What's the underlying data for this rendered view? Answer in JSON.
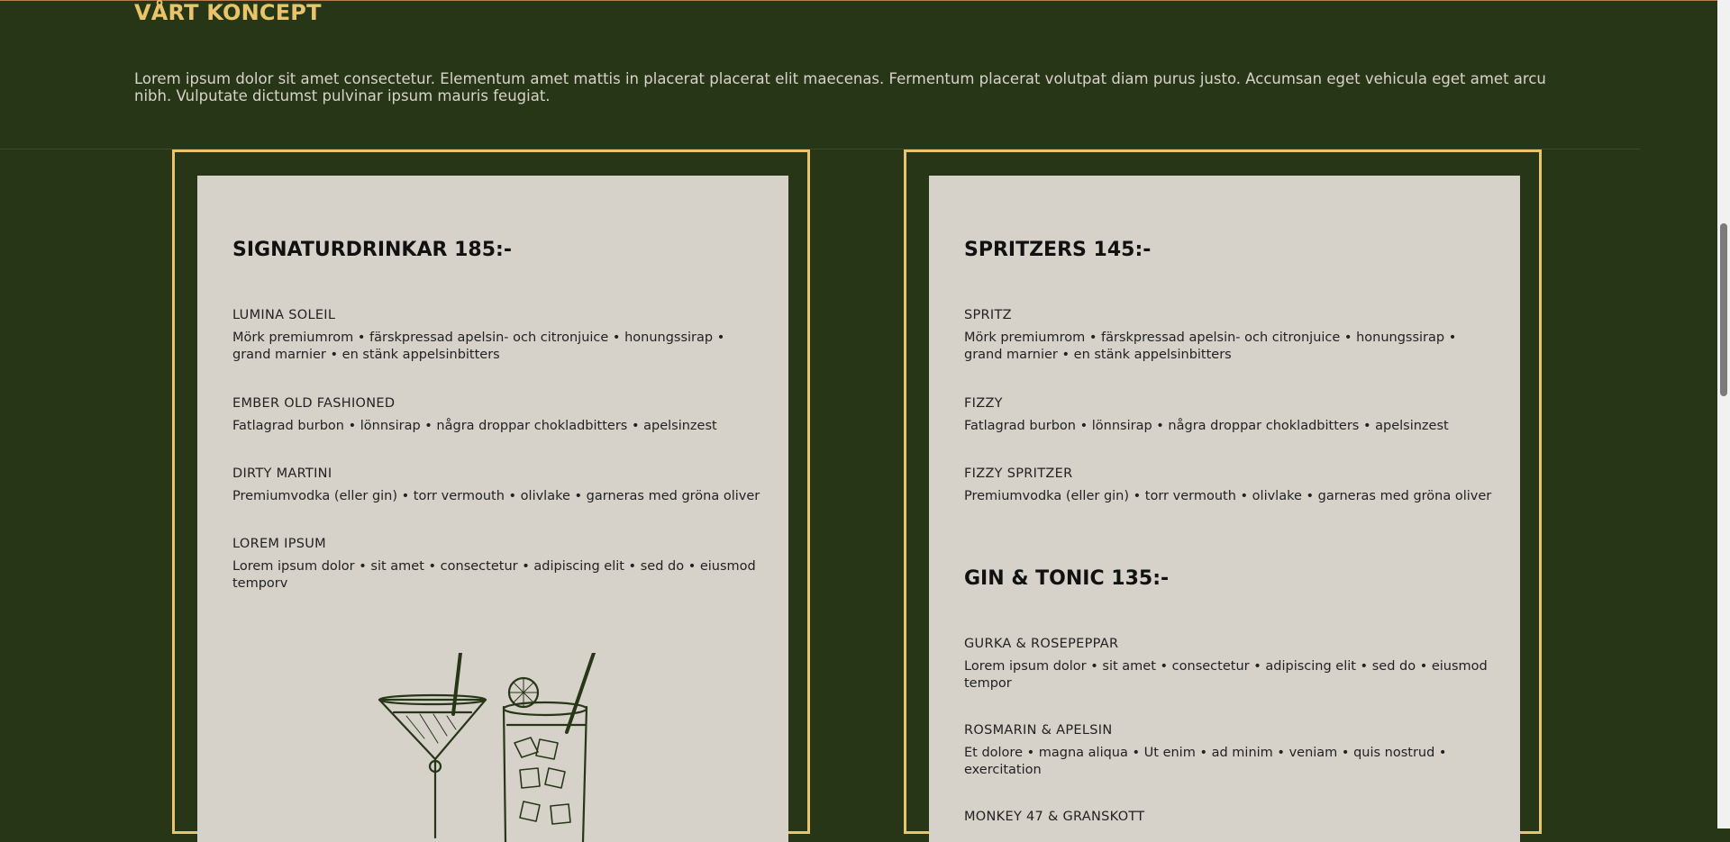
{
  "concept": {
    "title": "VÅRT KONCEPT",
    "text": "Lorem ipsum dolor sit amet consectetur. Elementum amet mattis in placerat placerat elit maecenas. Fermentum placerat volutpat diam purus justo. Accumsan eget vehicula eget amet arcu nibh. Vulputate dictumst pulvinar ipsum mauris feugiat."
  },
  "left_menu": {
    "title": "SIGNATURDRINKAR 185:-",
    "items": [
      {
        "name": "LUMINA SOLEIL",
        "desc": "Mörk premiumrom • färskpressad apelsin- och citronjuice • honungssirap • grand marnier • en stänk appelsinbitters"
      },
      {
        "name": "EMBER OLD FASHIONED",
        "desc": "Fatlagrad burbon • lönnsirap • några droppar chokladbitters • apelsinzest"
      },
      {
        "name": "DIRTY MARTINI",
        "desc": "Premiumvodka (eller gin) • torr vermouth • olivlake • garneras med gröna oliver"
      },
      {
        "name": "LOREM IPSUM",
        "desc": "Lorem ipsum dolor • sit amet • consectetur • adipiscing elit • sed do • eiusmod temporv"
      }
    ],
    "illustration_icon": "cocktail-glasses-illustration"
  },
  "right_menu": {
    "sections": [
      {
        "title": "SPRITZERS 145:-",
        "items": [
          {
            "name": "SPRITZ",
            "desc": "Mörk premiumrom • färskpressad apelsin- och citronjuice • honungssirap • grand marnier • en stänk appelsinbitters"
          },
          {
            "name": "FIZZY",
            "desc": "Fatlagrad burbon • lönnsirap • några droppar chokladbitters • apelsinzest"
          },
          {
            "name": "FIZZY SPRITZER",
            "desc": "Premiumvodka (eller gin) • torr vermouth • olivlake • garneras med gröna oliver"
          }
        ]
      },
      {
        "title": "GIN & TONIC 135:-",
        "items": [
          {
            "name": "GURKA & ROSEPEPPAR",
            "desc": "Lorem ipsum dolor • sit amet • consectetur • adipiscing elit • sed do • eiusmod tempor"
          },
          {
            "name": "ROSMARIN & APELSIN",
            "desc": "Et dolore • magna aliqua • Ut enim • ad minim • veniam • quis nostrud • exercitation"
          },
          {
            "name": "MONKEY 47 & GRANSKOTT",
            "desc": ""
          }
        ]
      }
    ]
  },
  "colors": {
    "background": "#283618",
    "accent": "#e9c46a",
    "card": "#d6d2ca"
  }
}
